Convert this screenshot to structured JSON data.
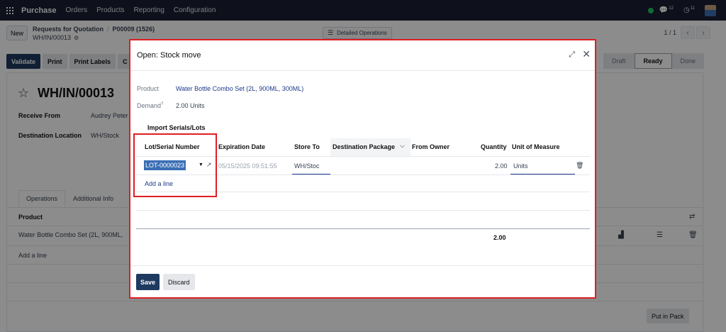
{
  "navbar": {
    "brand": "Purchase",
    "menu": [
      "Orders",
      "Products",
      "Reporting",
      "Configuration"
    ],
    "chat_count": "12",
    "activity_count": "11"
  },
  "control": {
    "new_label": "New",
    "breadcrumb_parent": "Requests for Quotation",
    "breadcrumb_order": "P00009 (1526)",
    "breadcrumb_current": "WH/IN/00013",
    "detailed_label": "Detailed Operations",
    "pager": "1 / 1"
  },
  "actions": {
    "validate": "Validate",
    "print": "Print",
    "print_labels": "Print Labels",
    "cancel_short": "C"
  },
  "statusbar": [
    "Draft",
    "Ready",
    "Done"
  ],
  "form": {
    "title": "WH/IN/00013",
    "receive_from_label": "Receive From",
    "receive_from_value": "Audrey Peter",
    "destination_label": "Destination Location",
    "destination_value": "WH/Stock",
    "tabs": [
      "Operations",
      "Additional Info"
    ],
    "product_header": "Product",
    "product_row": "Water Bottle Combo Set (2L, 900ML,",
    "add_line": "Add a line",
    "put_in_pack": "Put in Pack"
  },
  "modal": {
    "title": "Open: Stock move",
    "product_label": "Product",
    "product_value": "Water Bottle Combo Set (2L, 900ML, 300ML)",
    "demand_label": "Demand",
    "demand_help": "?",
    "demand_value": "2.00 Units",
    "import_label": "Import Serials/Lots",
    "columns": {
      "lot": "Lot/Serial Number",
      "expiration": "Expiration Date",
      "store_to": "Store To",
      "dest_package": "Destination Package",
      "from_owner": "From Owner",
      "quantity": "Quantity",
      "uom": "Unit of Measure"
    },
    "row": {
      "lot": "LOT-0000023",
      "expiration": "05/15/2025 09:51:55",
      "store_to": "WH/Stoc",
      "quantity": "2.00",
      "uom": "Units"
    },
    "add_line": "Add a line",
    "total": "2.00",
    "save": "Save",
    "discard": "Discard"
  }
}
